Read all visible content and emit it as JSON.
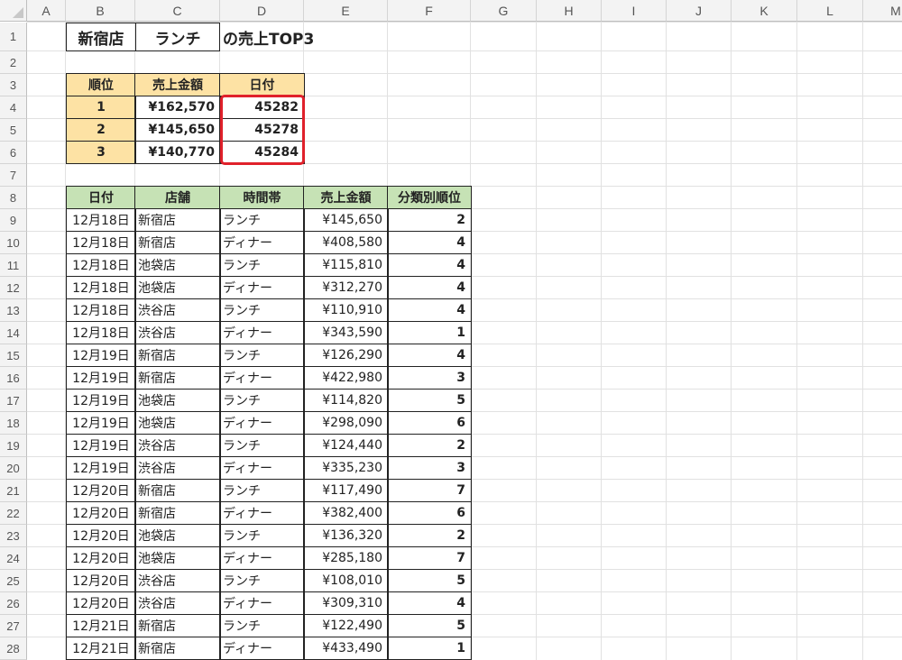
{
  "columns": [
    "A",
    "B",
    "C",
    "D",
    "E",
    "F",
    "G",
    "H",
    "I",
    "J",
    "K",
    "L",
    "M"
  ],
  "rows": [
    "1",
    "2",
    "3",
    "4",
    "5",
    "6",
    "7",
    "8",
    "9",
    "10",
    "11",
    "12",
    "13",
    "14",
    "15",
    "16",
    "17",
    "18",
    "19",
    "20",
    "21",
    "22",
    "23",
    "24",
    "25",
    "26",
    "27",
    "28"
  ],
  "title": {
    "store": "新宿店",
    "period": "ランチ",
    "suffix": "の売上TOP3"
  },
  "top3": {
    "headers": [
      "順位",
      "売上金額",
      "日付"
    ],
    "rows": [
      [
        "1",
        "¥162,570",
        "45282"
      ],
      [
        "2",
        "¥145,650",
        "45278"
      ],
      [
        "3",
        "¥140,770",
        "45284"
      ]
    ]
  },
  "sales": {
    "headers": [
      "日付",
      "店舗",
      "時間帯",
      "売上金額",
      "分類別順位"
    ],
    "rows": [
      [
        "12月18日",
        "新宿店",
        "ランチ",
        "¥145,650",
        "2"
      ],
      [
        "12月18日",
        "新宿店",
        "ディナー",
        "¥408,580",
        "4"
      ],
      [
        "12月18日",
        "池袋店",
        "ランチ",
        "¥115,810",
        "4"
      ],
      [
        "12月18日",
        "池袋店",
        "ディナー",
        "¥312,270",
        "4"
      ],
      [
        "12月18日",
        "渋谷店",
        "ランチ",
        "¥110,910",
        "4"
      ],
      [
        "12月18日",
        "渋谷店",
        "ディナー",
        "¥343,590",
        "1"
      ],
      [
        "12月19日",
        "新宿店",
        "ランチ",
        "¥126,290",
        "4"
      ],
      [
        "12月19日",
        "新宿店",
        "ディナー",
        "¥422,980",
        "3"
      ],
      [
        "12月19日",
        "池袋店",
        "ランチ",
        "¥114,820",
        "5"
      ],
      [
        "12月19日",
        "池袋店",
        "ディナー",
        "¥298,090",
        "6"
      ],
      [
        "12月19日",
        "渋谷店",
        "ランチ",
        "¥124,440",
        "2"
      ],
      [
        "12月19日",
        "渋谷店",
        "ディナー",
        "¥335,230",
        "3"
      ],
      [
        "12月20日",
        "新宿店",
        "ランチ",
        "¥117,490",
        "7"
      ],
      [
        "12月20日",
        "新宿店",
        "ディナー",
        "¥382,400",
        "6"
      ],
      [
        "12月20日",
        "池袋店",
        "ランチ",
        "¥136,320",
        "2"
      ],
      [
        "12月20日",
        "池袋店",
        "ディナー",
        "¥285,180",
        "7"
      ],
      [
        "12月20日",
        "渋谷店",
        "ランチ",
        "¥108,010",
        "5"
      ],
      [
        "12月20日",
        "渋谷店",
        "ディナー",
        "¥309,310",
        "4"
      ],
      [
        "12月21日",
        "新宿店",
        "ランチ",
        "¥122,490",
        "5"
      ],
      [
        "12月21日",
        "新宿店",
        "ディナー",
        "¥433,490",
        "1"
      ]
    ]
  },
  "colors": {
    "header_orange": "#fde2a4",
    "header_green": "#c6e2b5",
    "highlight_red": "#e0212b"
  }
}
